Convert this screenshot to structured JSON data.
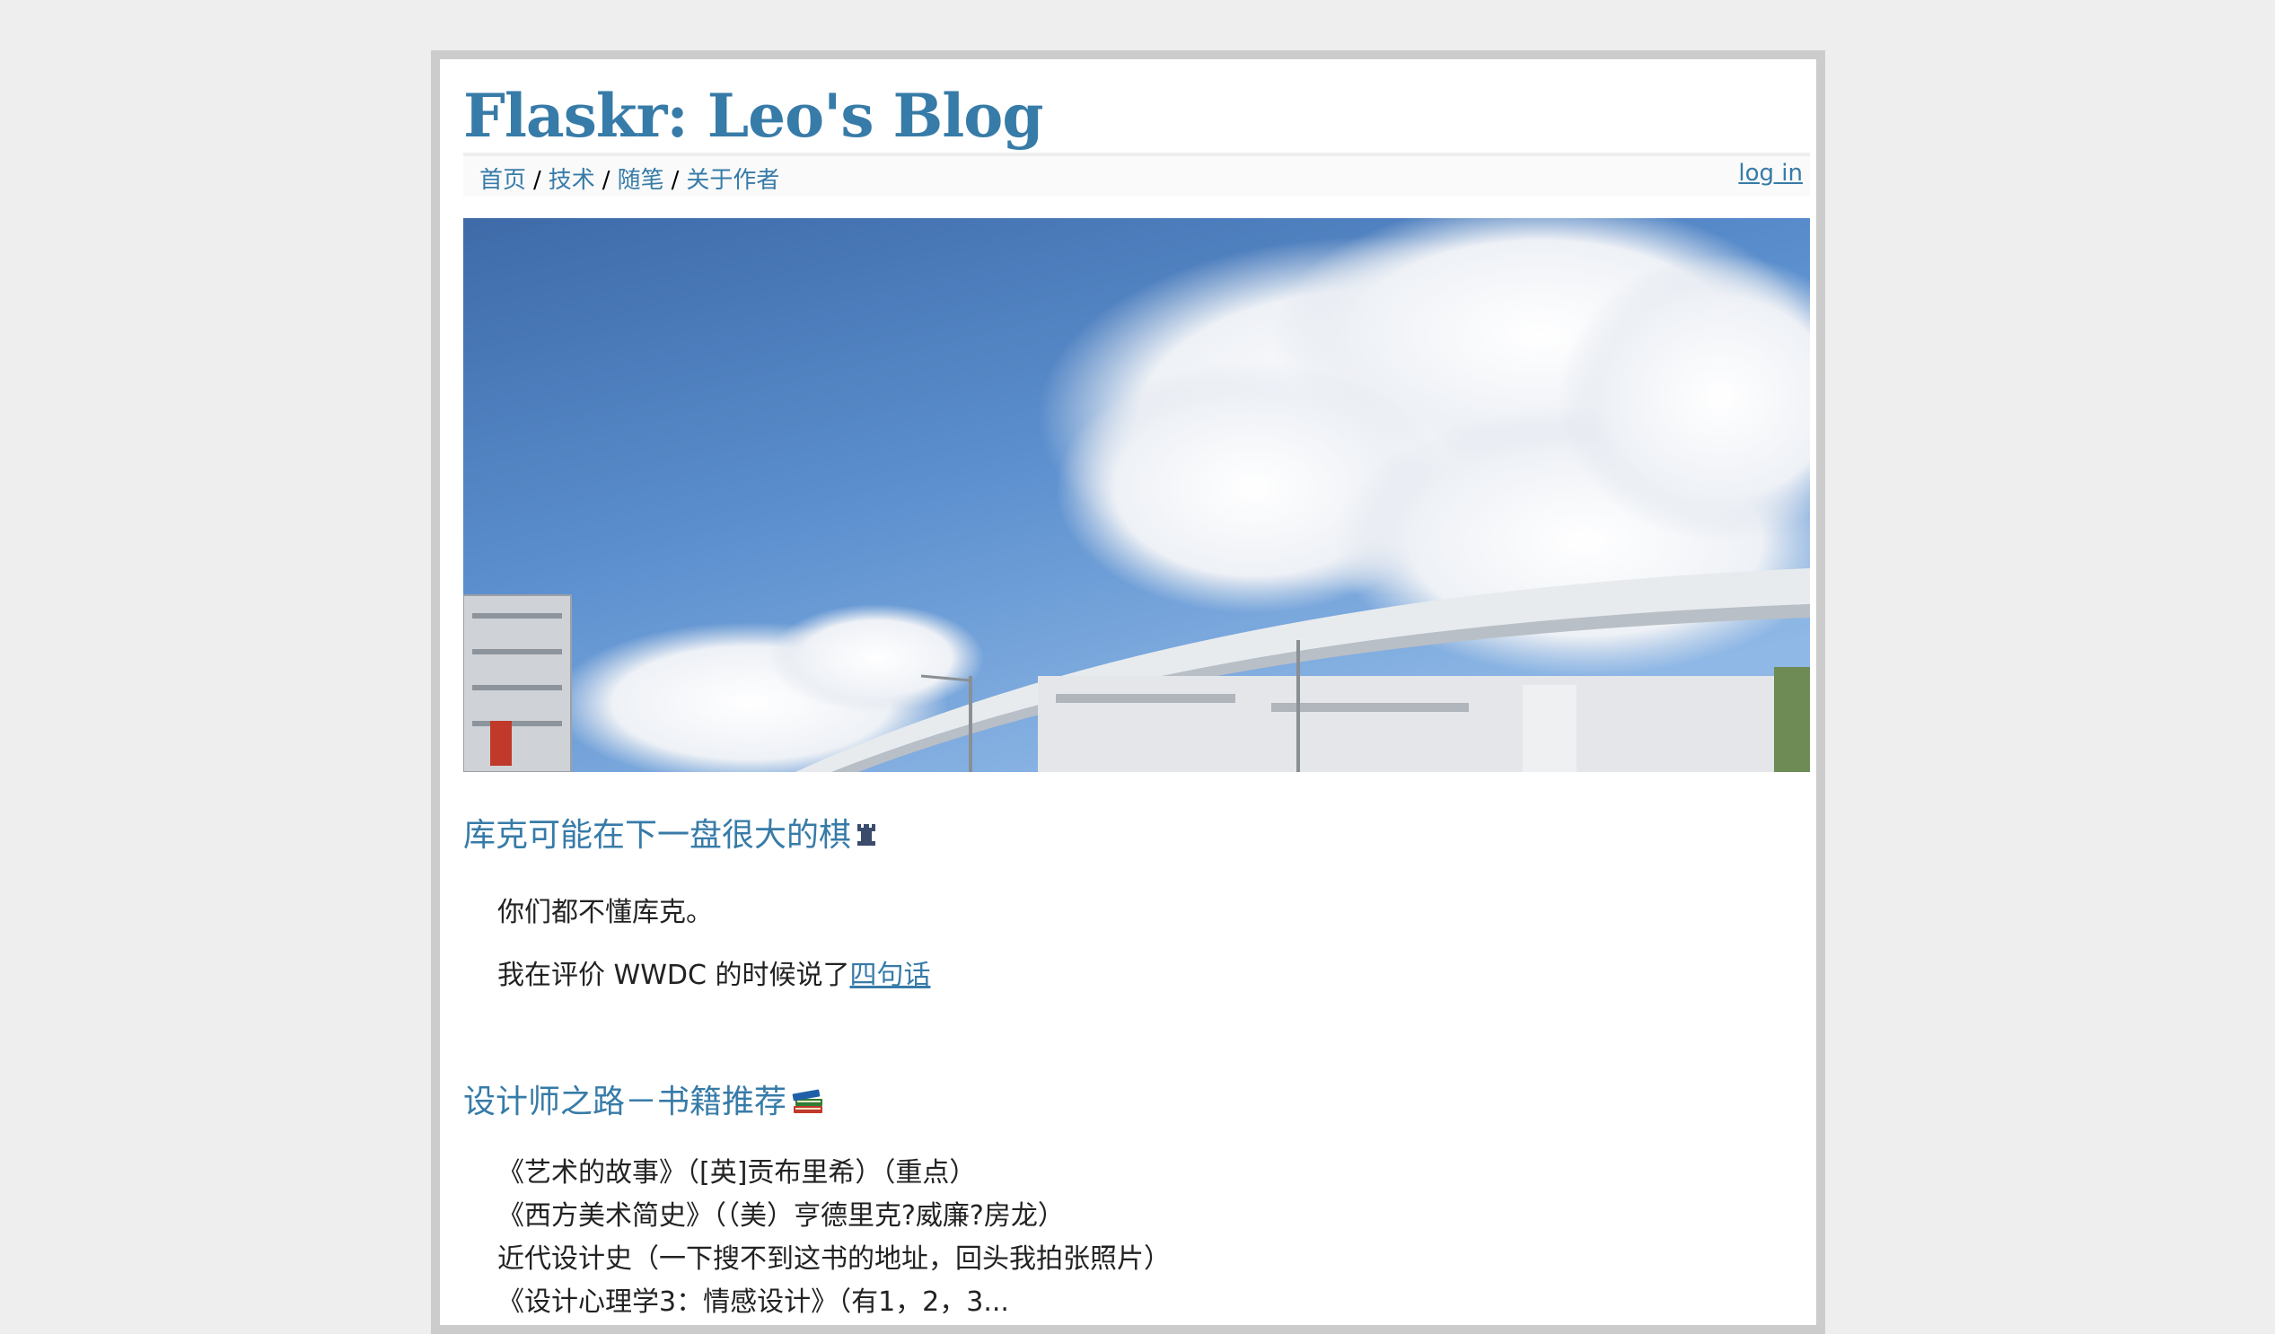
{
  "site": {
    "title": "Flaskr: Leo's Blog"
  },
  "nav": {
    "items": [
      {
        "label": "首页"
      },
      {
        "label": "技术"
      },
      {
        "label": "随笔"
      },
      {
        "label": "关于作者"
      }
    ],
    "separator": "/",
    "login_label": "log in"
  },
  "colors": {
    "link": "#377ba8",
    "frame": "#cccccc",
    "background": "#eeeeee"
  },
  "posts": [
    {
      "title": "库克可能在下一盘很大的棋",
      "title_icon": "chess-rook-icon",
      "paragraphs": [
        {
          "text": "你们都不懂库克。"
        },
        {
          "text": "我在评价 WWDC 的时候说了",
          "link_text": "四句话"
        }
      ]
    },
    {
      "title": "设计师之路－书籍推荐",
      "title_icon": "books-icon",
      "lines": [
        "《艺术的故事》（[英]贡布里希）（重点）",
        "《西方美术简史》（（美）亨德里克?威廉?房龙）",
        "近代设计史（一下搜不到这书的地址，回头我拍张照片）",
        "《设计心理学3：情感设计》（有1，2，3..."
      ]
    }
  ]
}
